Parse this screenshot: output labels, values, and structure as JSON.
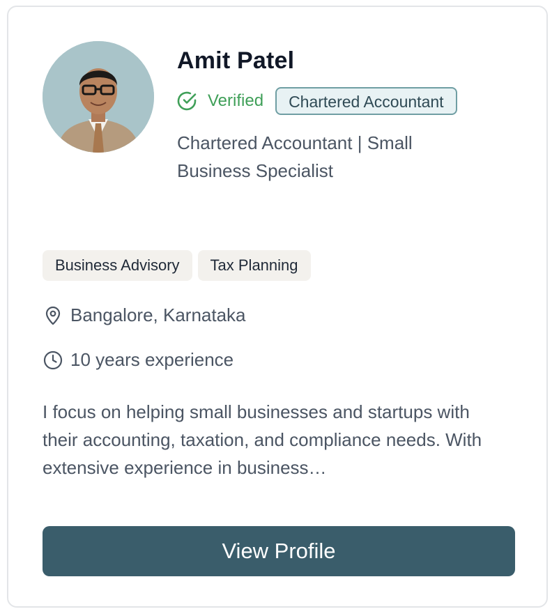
{
  "profile": {
    "name": "Amit Patel",
    "verified_label": "Verified",
    "role_badge": "Chartered Accountant",
    "headline": "Chartered Accountant | Small Business Specialist",
    "tags": [
      "Business Advisory",
      "Tax Planning"
    ],
    "location": "Bangalore, Karnataka",
    "experience": "10 years experience",
    "bio": "I focus on helping small businesses and startups with their accounting, taxation, and compliance needs. With extensive experience in business…",
    "cta_label": "View Profile"
  },
  "icons": {
    "verified": "check-circle-icon",
    "location": "map-pin-icon",
    "experience": "clock-icon"
  },
  "colors": {
    "accent": "#3a5d6b",
    "verified": "#3f9f58",
    "badge_border": "#6f9ea3",
    "badge_bg": "#e8f2f4",
    "tag_bg": "#f3f1ed"
  }
}
